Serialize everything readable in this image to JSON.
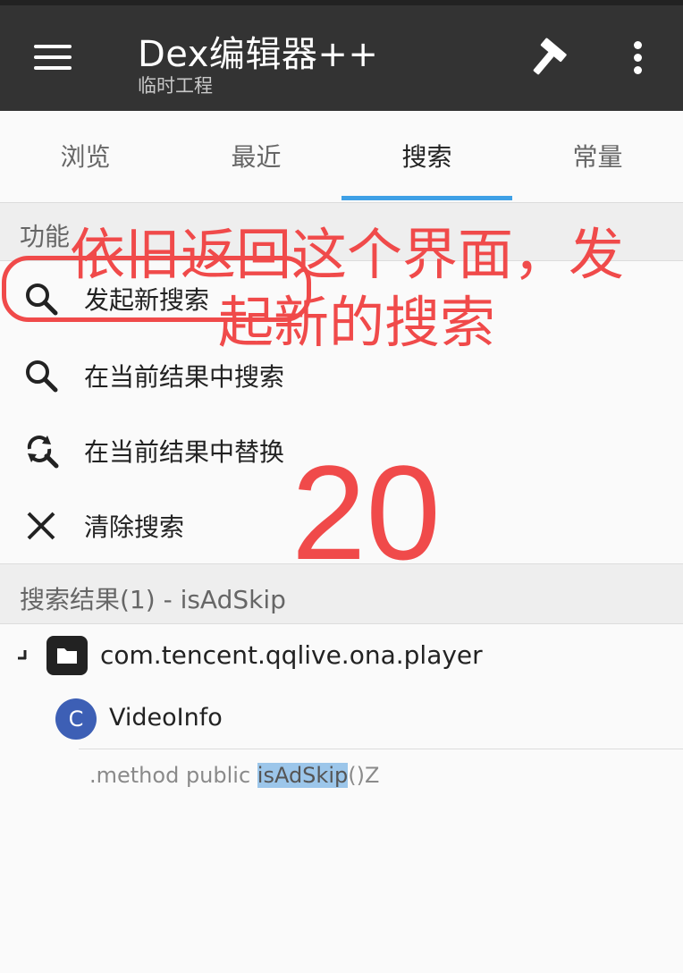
{
  "appbar": {
    "title": "Dex编辑器++",
    "subtitle": "临时工程",
    "menu_icon": "hamburger-menu-icon",
    "build_icon": "hammer-icon",
    "overflow_icon": "more-vert-icon"
  },
  "tabs": [
    {
      "label": "浏览",
      "active": false
    },
    {
      "label": "最近",
      "active": false
    },
    {
      "label": "搜索",
      "active": true
    },
    {
      "label": "常量",
      "active": false
    }
  ],
  "functions": {
    "header": "功能",
    "items": [
      {
        "label": "发起新搜索",
        "icon": "search-icon"
      },
      {
        "label": "在当前结果中搜索",
        "icon": "search-icon"
      },
      {
        "label": "在当前结果中替换",
        "icon": "search-replace-icon"
      },
      {
        "label": "清除搜索",
        "icon": "close-icon"
      }
    ]
  },
  "results": {
    "header": "搜索结果(1) - isAdSkip",
    "package": "com.tencent.qqlive.ona.player",
    "class_badge": "C",
    "class_name": "VideoInfo",
    "method_prefix": ".method public ",
    "method_match": "isAdSkip",
    "method_suffix": "()Z"
  },
  "annotation": {
    "line1": "依旧返回这个界面，发",
    "line2": "起新的搜索",
    "step": "20",
    "color": "#f04a4a"
  }
}
